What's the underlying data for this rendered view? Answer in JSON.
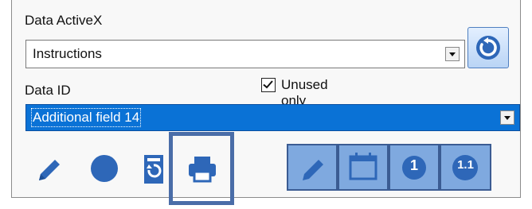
{
  "data_activex": {
    "label": "Data ActiveX",
    "value": "Instructions"
  },
  "data_id": {
    "label": "Data ID",
    "value": "Additional field 14"
  },
  "unused_only": {
    "label": "Unused only",
    "checked": true
  },
  "icons": {
    "refresh": "refresh-icon",
    "edit": "pencil-icon",
    "circle": "circle-icon",
    "restore": "restore-icon",
    "print": "printer-icon",
    "toggle_edit": "pencil-icon",
    "calendar": "calendar-icon",
    "number_one": "one-icon",
    "decimal": "one-point-one-icon"
  },
  "decimal_badge": "1.1",
  "number_badge": "1",
  "colors": {
    "accent": "#2e67b8",
    "selection": "#0a72d6",
    "toggle_bg": "#7fa9df"
  }
}
